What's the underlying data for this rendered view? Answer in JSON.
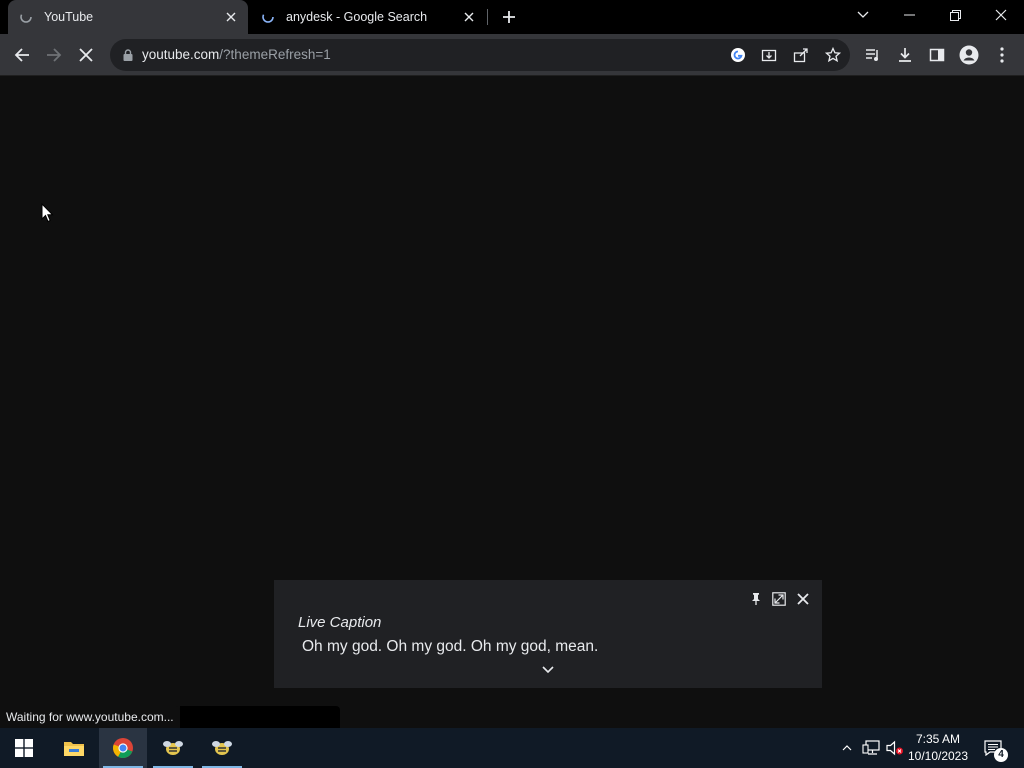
{
  "tabs": [
    {
      "title": "YouTube",
      "active": true,
      "favicon": "youtube-loading-icon"
    },
    {
      "title": "anydesk - Google Search",
      "active": false,
      "favicon": "google-loading-icon"
    }
  ],
  "address_bar": {
    "host": "youtube.com",
    "path": "/?themeRefresh=1"
  },
  "live_caption": {
    "title": "Live Caption",
    "text": "Oh my god. Oh my god. Oh my god, mean."
  },
  "status_bar": {
    "text": "Waiting for www.youtube.com..."
  },
  "taskbar": {
    "time": "7:35 AM",
    "date": "10/10/2023",
    "notification_count": "4",
    "apps": [
      "start-menu",
      "file-explorer",
      "google-chrome",
      "app-1",
      "app-2"
    ]
  },
  "colors": {
    "page_background": "#0f0f0f",
    "toolbar": "#35363a",
    "taskbar": "#101a26"
  }
}
